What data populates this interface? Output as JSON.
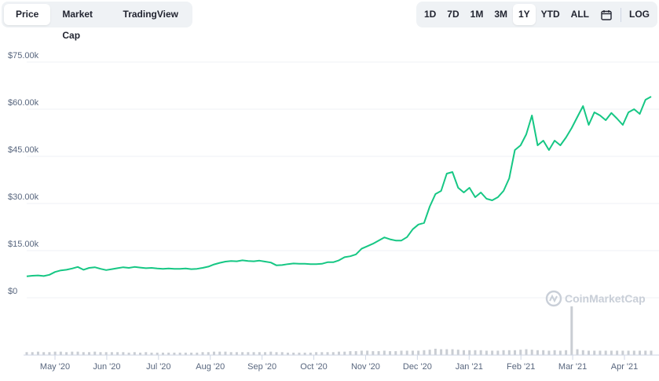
{
  "tabs": [
    {
      "label": "Price",
      "active": true
    },
    {
      "label": "Market Cap",
      "active": false
    },
    {
      "label": "TradingView",
      "active": false
    }
  ],
  "ranges": [
    {
      "label": "1D",
      "active": false
    },
    {
      "label": "7D",
      "active": false
    },
    {
      "label": "1M",
      "active": false
    },
    {
      "label": "3M",
      "active": false
    },
    {
      "label": "1Y",
      "active": true
    },
    {
      "label": "YTD",
      "active": false
    },
    {
      "label": "ALL",
      "active": false
    }
  ],
  "calendar_icon": "calendar-icon",
  "log_label": "LOG",
  "watermark": "CoinMarketCap",
  "colors": {
    "line": "#16c784",
    "grid": "#eff2f5",
    "volume": "#c9cdd3",
    "axis": "#58667e"
  },
  "chart_data": {
    "type": "line",
    "title": "",
    "xlabel": "",
    "ylabel": "",
    "ylim": [
      0,
      75000
    ],
    "y_ticks": [
      "$0",
      "$15.00k",
      "$30.00k",
      "$45.00k",
      "$60.00k",
      "$75.00k"
    ],
    "x_ticks": [
      "May '20",
      "Jun '20",
      "Jul '20",
      "Aug '20",
      "Sep '20",
      "Oct '20",
      "Nov '20",
      "Dec '20",
      "Jan '21",
      "Feb '21",
      "Mar '21",
      "Apr '21"
    ],
    "grid": true,
    "series": [
      {
        "values": [
          6800,
          7000,
          7100,
          6900,
          7300,
          8200,
          8700,
          8900,
          9300,
          9800,
          8900,
          9500,
          9700,
          9200,
          8800,
          9100,
          9400,
          9700,
          9500,
          9800,
          9600,
          9400,
          9500,
          9300,
          9200,
          9300,
          9200,
          9200,
          9300,
          9100,
          9200,
          9500,
          9900,
          10600,
          11100,
          11500,
          11700,
          11600,
          11900,
          11700,
          11600,
          11800,
          11500,
          11200,
          10300,
          10400,
          10700,
          10900,
          10800,
          10800,
          10700,
          10700,
          10800,
          11300,
          11300,
          11900,
          12900,
          13200,
          13800,
          15600,
          16400,
          17200,
          18200,
          19200,
          18600,
          18200,
          18200,
          19300,
          21800,
          23300,
          23800,
          29000,
          33000,
          34000,
          39500,
          40000,
          35000,
          33500,
          35000,
          32000,
          33500,
          31500,
          31000,
          32000,
          34000,
          38000,
          47000,
          48500,
          52000,
          58000,
          48500,
          50000,
          47000,
          50000,
          48500,
          51000,
          54000,
          57500,
          61000,
          55000,
          59000,
          58000,
          56500,
          58800,
          57000,
          55000,
          59000,
          60000,
          58500,
          63000,
          64000
        ],
        "volume": [
          0.06,
          0.06,
          0.07,
          0.06,
          0.06,
          0.07,
          0.07,
          0.06,
          0.07,
          0.07,
          0.06,
          0.06,
          0.07,
          0.06,
          0.06,
          0.06,
          0.06,
          0.06,
          0.05,
          0.06,
          0.05,
          0.06,
          0.05,
          0.05,
          0.05,
          0.05,
          0.05,
          0.05,
          0.05,
          0.05,
          0.05,
          0.06,
          0.06,
          0.07,
          0.07,
          0.07,
          0.06,
          0.06,
          0.06,
          0.06,
          0.06,
          0.06,
          0.06,
          0.07,
          0.06,
          0.06,
          0.05,
          0.05,
          0.05,
          0.05,
          0.05,
          0.06,
          0.06,
          0.06,
          0.06,
          0.07,
          0.07,
          0.08,
          0.08,
          0.09,
          0.09,
          0.08,
          0.08,
          0.09,
          0.08,
          0.08,
          0.09,
          0.09,
          0.09,
          0.09,
          0.1,
          0.11,
          0.13,
          0.12,
          0.12,
          0.12,
          0.11,
          0.1,
          0.1,
          0.1,
          0.1,
          0.09,
          0.09,
          0.09,
          0.1,
          0.1,
          0.1,
          0.11,
          0.12,
          0.11,
          0.1,
          0.1,
          0.09,
          0.1,
          0.09,
          0.1,
          1.0,
          0.12,
          0.1,
          0.09,
          0.09,
          0.09,
          0.09,
          0.09,
          0.09,
          0.09,
          0.09,
          0.09,
          0.09,
          0.09,
          0.09
        ]
      }
    ]
  }
}
